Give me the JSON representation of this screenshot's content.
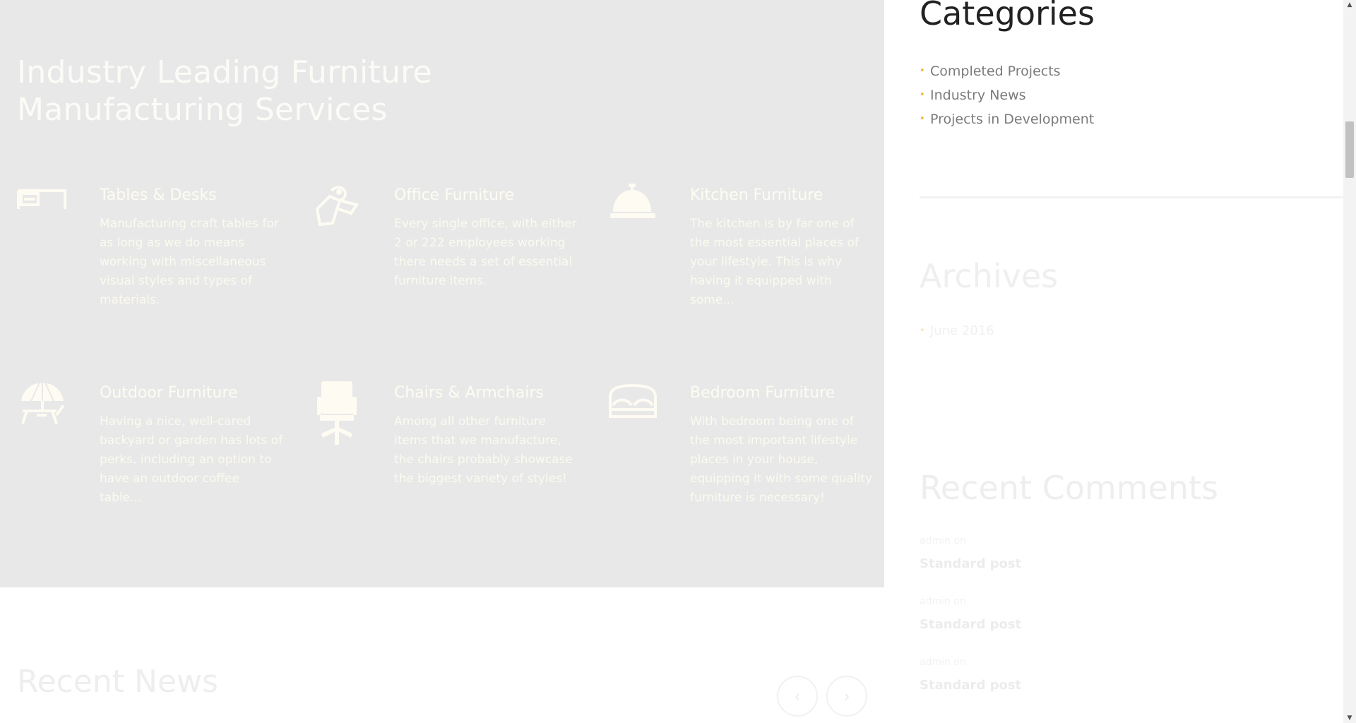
{
  "services": {
    "title": "Industry Leading Furniture Manufacturing Services",
    "items": [
      {
        "icon": "desk-icon",
        "title": "Tables & Desks",
        "text": "Manufacturing craft tables for as long as we do means working with miscellaneous visual styles and types of materials."
      },
      {
        "icon": "price-tag-icon",
        "title": "Office Furniture",
        "text": "Every single office, with either 2 or 222 employees working there needs a set of essential furniture items."
      },
      {
        "icon": "service-bell-icon",
        "title": "Kitchen Furniture",
        "text": "The kitchen is by far one of the most essential places of your lifestyle. This is why having it equipped with some..."
      },
      {
        "icon": "beach-umbrella-icon",
        "title": "Outdoor Furniture",
        "text": "Having a nice, well-cared backyard or garden has lots of perks, including an option to have an outdoor coffee table..."
      },
      {
        "icon": "office-chair-icon",
        "title": "Chairs & Armchairs",
        "text": "Among all other furniture items that we manufacture, the chairs probably showcase the biggest variety of styles!"
      },
      {
        "icon": "bed-icon",
        "title": "Bedroom Furniture",
        "text": "With bedroom being one of the most important lifestyle places in your house, equipping it with some quality furniture is necessary!"
      }
    ]
  },
  "news": {
    "title": "Recent News",
    "prev_icon": "chevron-left-icon",
    "next_icon": "chevron-right-icon"
  },
  "sidebar": {
    "categories": {
      "title": "Categories",
      "items": [
        "Completed Projects",
        "Industry News",
        "Projects in Development"
      ]
    },
    "archives": {
      "title": "Archives",
      "items": [
        "June 2016"
      ]
    },
    "recent_comments": {
      "title": "Recent Comments",
      "items": [
        {
          "meta": "admin on",
          "post": "Standard post"
        },
        {
          "meta": "admin on",
          "post": "Standard post"
        },
        {
          "meta": "admin on",
          "post": "Standard post"
        }
      ]
    }
  },
  "colors": {
    "accent": "#f1b83b",
    "panel_bg": "#e8e8e8",
    "icon_fill": "#fdfbf2"
  }
}
